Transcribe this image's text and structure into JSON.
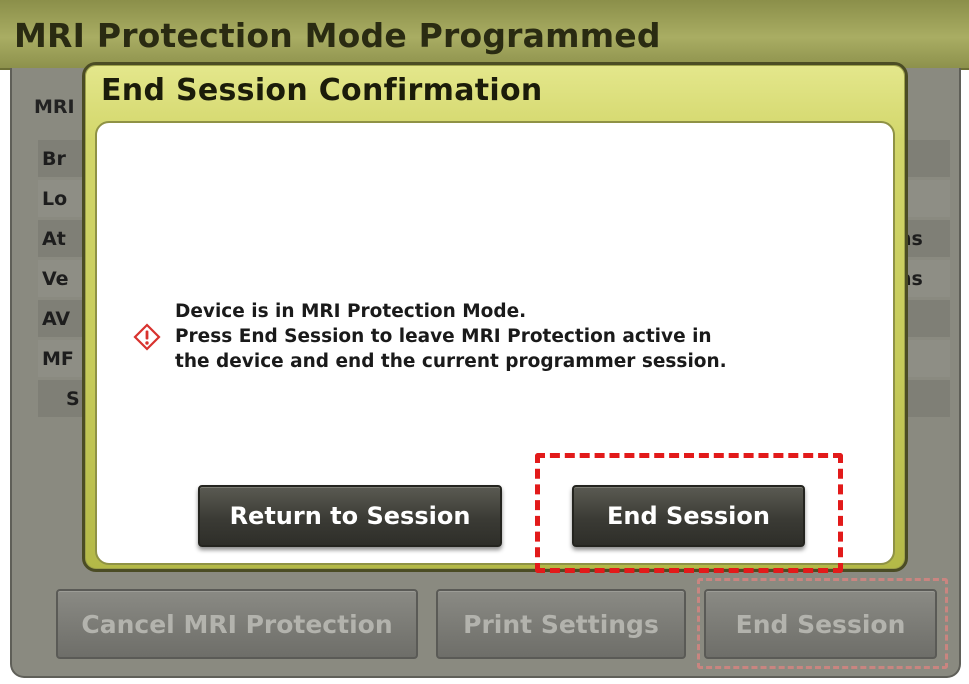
{
  "background": {
    "title": "MRI Protection Mode Programmed",
    "section_label": "MRI",
    "rows": [
      {
        "label": "Br",
        "unit": ""
      },
      {
        "label": "Lo",
        "unit": ""
      },
      {
        "label": "At",
        "unit": "ns"
      },
      {
        "label": "Ve",
        "unit": "ns"
      },
      {
        "label": "AV",
        "unit": ""
      },
      {
        "label": "MF",
        "unit": ""
      },
      {
        "label": "S",
        "unit": ""
      }
    ],
    "buttons": {
      "cancel_mri": "Cancel MRI Protection",
      "print_settings": "Print Settings",
      "end_session": "End Session"
    }
  },
  "dialog": {
    "title": "End Session Confirmation",
    "message_line1": "Device is in MRI Protection Mode.",
    "message_line2": "Press End Session to leave MRI Protection active in",
    "message_line3": "the device and end the current programmer session.",
    "return_button": "Return to Session",
    "end_button": "End Session"
  },
  "colors": {
    "dialog_gold": "#c6cb5a",
    "button_dark": "#3b3b35",
    "highlight_red": "#e21a1a"
  },
  "icons": {
    "warning": "warning-diamond-icon"
  }
}
